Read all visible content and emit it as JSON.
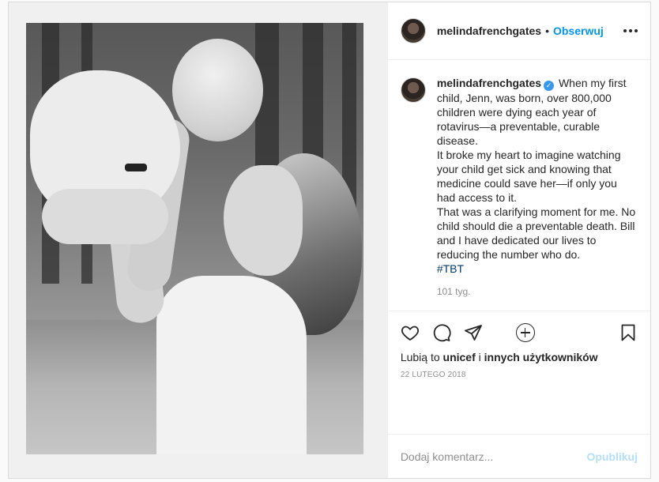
{
  "post": {
    "author": {
      "username": "melindafrenchgates",
      "follow_label": "Obserwuj",
      "separator": "•"
    },
    "image": {
      "alt": "Black and white photo of a mother lifting a toddler in the air outdoors"
    },
    "caption": {
      "username": "melindafrenchgates",
      "verified_icon": "verified-badge-icon",
      "text": "When my first child, Jenn, was born, over 800,000 children were dying each year of rotavirus—a preventable, curable disease.\nIt broke my heart to imagine watching your child get sick and knowing that medicine could save her—if only you had access to it.\nThat was a clarifying moment for me. No child should die a preventable death. Bill and I have dedicated our lives to reducing the number who do.",
      "hashtag": "#TBT",
      "age": "101 tyg."
    },
    "likes": {
      "prefix": "Lubią to",
      "user": "unicef",
      "connector": "i",
      "others": "innych użytkowników"
    },
    "date": "22 LUTEGO 2018",
    "comment_box": {
      "placeholder": "Dodaj komentarz...",
      "publish_label": "Opublikuj"
    },
    "colors": {
      "accent": "#0095f6",
      "publish_disabled": "#b2dffc",
      "hashtag": "#00376b"
    }
  }
}
